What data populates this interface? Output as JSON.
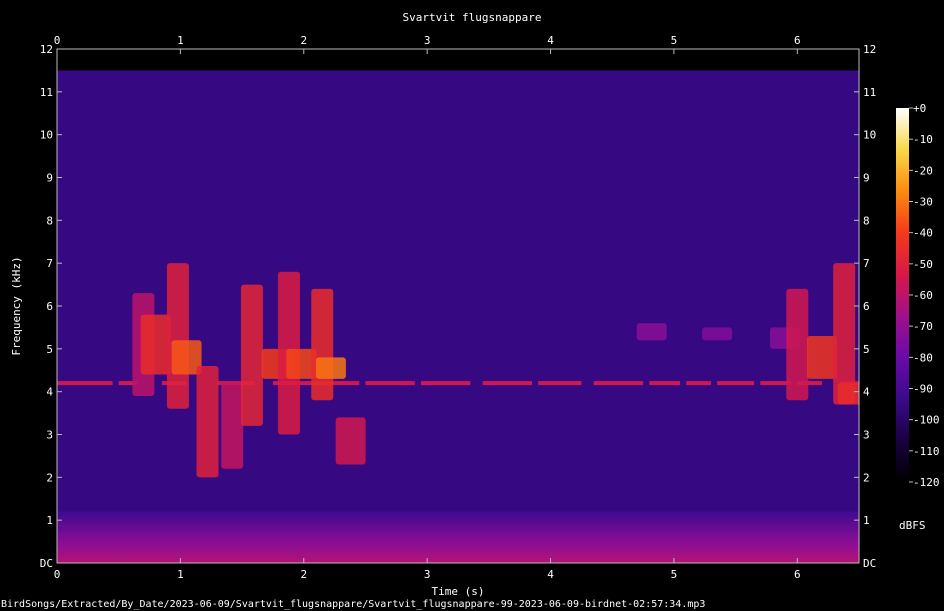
{
  "chart_data": {
    "type": "heatmap",
    "title": "Svartvit flugsnappare",
    "xlabel": "Time (s)",
    "ylabel": "Frequency (kHz)",
    "xlim": [
      0,
      6.5
    ],
    "ylim": [
      0,
      12
    ],
    "x_ticks": [
      "0",
      "1",
      "2",
      "3",
      "4",
      "5",
      "6"
    ],
    "y_ticks": [
      "DC",
      "1",
      "2",
      "3",
      "4",
      "5",
      "6",
      "7",
      "8",
      "9",
      "10",
      "11",
      "12"
    ],
    "colorbar": {
      "label": "dBFS",
      "ticks": [
        "+0",
        "-10",
        "-20",
        "-30",
        "-40",
        "-50",
        "-60",
        "-70",
        "-80",
        "-90",
        "-100",
        "-110",
        "-120"
      ],
      "range": [
        -120,
        0
      ]
    },
    "colormap": [
      "#000000",
      "#1a0040",
      "#3a0a8c",
      "#6a0aa8",
      "#a0108a",
      "#d81848",
      "#f43a1a",
      "#fb8a10",
      "#f8d84a",
      "#ffffff"
    ],
    "background_level_dbfs": -95,
    "tone_track": {
      "freq_khz": 4.2,
      "level_dbfs": -55,
      "segments": [
        [
          0.0,
          0.45
        ],
        [
          0.5,
          0.65
        ],
        [
          0.85,
          1.05
        ],
        [
          1.3,
          1.6
        ],
        [
          1.75,
          2.45
        ],
        [
          2.5,
          2.9
        ],
        [
          2.95,
          3.35
        ],
        [
          3.45,
          3.85
        ],
        [
          3.9,
          4.25
        ],
        [
          4.35,
          4.75
        ],
        [
          4.8,
          5.05
        ],
        [
          5.1,
          5.3
        ],
        [
          5.35,
          5.65
        ],
        [
          5.7,
          5.95
        ],
        [
          6.0,
          6.2
        ],
        [
          6.35,
          6.5
        ]
      ]
    },
    "calls": [
      {
        "t": 0.7,
        "f_lo": 3.9,
        "f_hi": 6.3,
        "level_dbfs": -60
      },
      {
        "t": 0.8,
        "f_lo": 4.4,
        "f_hi": 5.8,
        "level_dbfs": -45
      },
      {
        "t": 0.98,
        "f_lo": 3.6,
        "f_hi": 7.0,
        "level_dbfs": -50
      },
      {
        "t": 1.05,
        "f_lo": 4.4,
        "f_hi": 5.2,
        "level_dbfs": -35
      },
      {
        "t": 1.22,
        "f_lo": 2.0,
        "f_hi": 4.6,
        "level_dbfs": -50
      },
      {
        "t": 1.42,
        "f_lo": 2.2,
        "f_hi": 4.2,
        "level_dbfs": -58
      },
      {
        "t": 1.58,
        "f_lo": 3.2,
        "f_hi": 6.5,
        "level_dbfs": -48
      },
      {
        "t": 1.78,
        "f_lo": 4.3,
        "f_hi": 5.0,
        "level_dbfs": -40
      },
      {
        "t": 1.88,
        "f_lo": 3.0,
        "f_hi": 6.8,
        "level_dbfs": -52
      },
      {
        "t": 1.98,
        "f_lo": 4.3,
        "f_hi": 5.0,
        "level_dbfs": -38
      },
      {
        "t": 2.15,
        "f_lo": 3.8,
        "f_hi": 6.4,
        "level_dbfs": -45
      },
      {
        "t": 2.22,
        "f_lo": 4.3,
        "f_hi": 4.8,
        "level_dbfs": -30
      },
      {
        "t": 2.38,
        "f_lo": 2.3,
        "f_hi": 3.4,
        "level_dbfs": -55
      },
      {
        "t": 4.82,
        "f_lo": 5.2,
        "f_hi": 5.6,
        "level_dbfs": -72
      },
      {
        "t": 5.35,
        "f_lo": 5.2,
        "f_hi": 5.5,
        "level_dbfs": -74
      },
      {
        "t": 5.9,
        "f_lo": 5.0,
        "f_hi": 5.5,
        "level_dbfs": -72
      },
      {
        "t": 6.0,
        "f_lo": 3.8,
        "f_hi": 6.4,
        "level_dbfs": -55
      },
      {
        "t": 6.2,
        "f_lo": 4.3,
        "f_hi": 5.3,
        "level_dbfs": -42
      },
      {
        "t": 6.38,
        "f_lo": 3.7,
        "f_hi": 7.0,
        "level_dbfs": -50
      },
      {
        "t": 6.45,
        "f_lo": 3.7,
        "f_hi": 4.2,
        "level_dbfs": -45
      }
    ],
    "grid": false
  },
  "footer": {
    "filename": "BirdSongs/Extracted/By_Date/2023-06-09/Svartvit_flugsnappare/Svartvit_flugsnappare-99-2023-06-09-birdnet-02:57:34.mp3"
  }
}
